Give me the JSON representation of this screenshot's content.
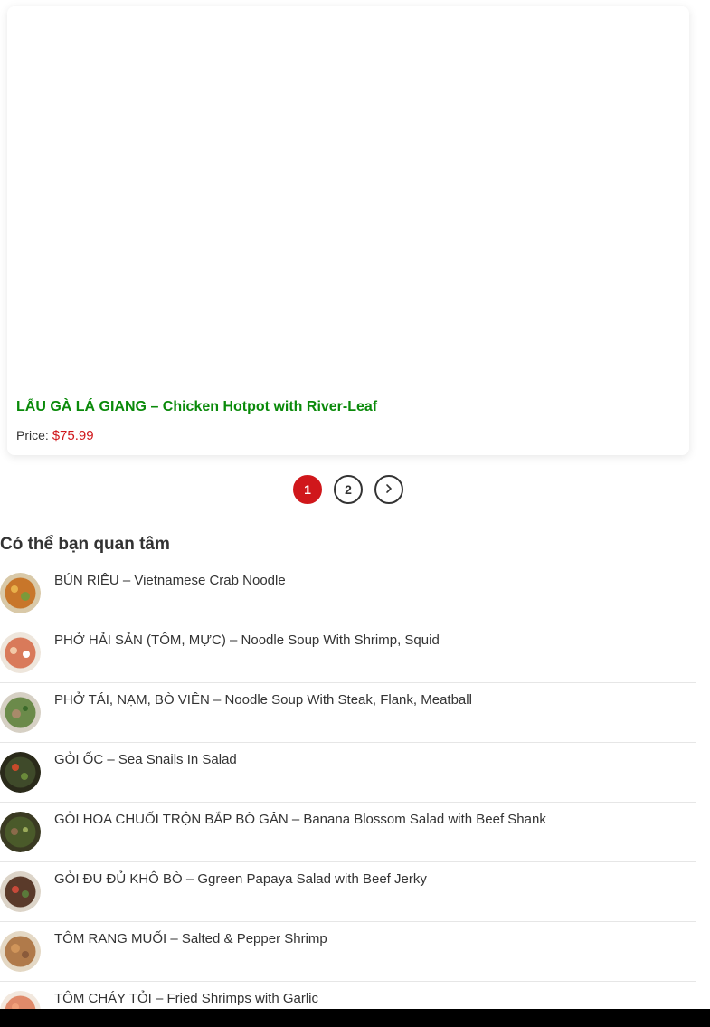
{
  "product": {
    "title": "LẨU GÀ LÁ GIANG – Chicken Hotpot with River-Leaf",
    "price_label": "Price:",
    "price_value": "$75.99"
  },
  "pagination": {
    "pages": [
      "1",
      "2"
    ],
    "current": "1",
    "next_icon": "chevron-right-icon"
  },
  "related": {
    "heading": "Có thể bạn quan tâm",
    "items": [
      {
        "label": "BÚN RIÊU – Vietnamese Crab Noodle",
        "thumb_color": "#c8762a"
      },
      {
        "label": "PHỞ HẢI SẢN (TÔM, MỰC) – Noodle Soup With Shrimp, Squid",
        "thumb_color": "#d97a5a"
      },
      {
        "label": "PHỞ TÁI, NẠM, BÒ VIÊN – Noodle Soup With Steak, Flank, Meatball",
        "thumb_color": "#6b8a4a"
      },
      {
        "label": "GỎI ỐC – Sea Snails In Salad",
        "thumb_color": "#3f4a2a"
      },
      {
        "label": "GỎI HOA CHUỐI TRỘN BẮP BÒ GÂN – Banana Blossom Salad with Beef Shank",
        "thumb_color": "#4a5a2a"
      },
      {
        "label": "GỎI ĐU ĐỦ KHÔ BÒ – Ggreen Papaya Salad with Beef Jerky",
        "thumb_color": "#5a3a2a"
      },
      {
        "label": "TÔM RANG MUỐI – Salted & Pepper Shrimp",
        "thumb_color": "#b07a4a"
      },
      {
        "label": "TÔM CHÁY TỎI – Fried Shrimps with Garlic",
        "thumb_color": "#e08a6a"
      }
    ]
  },
  "colors": {
    "accent_red": "#d0171b",
    "title_green": "#0a8a0a"
  }
}
